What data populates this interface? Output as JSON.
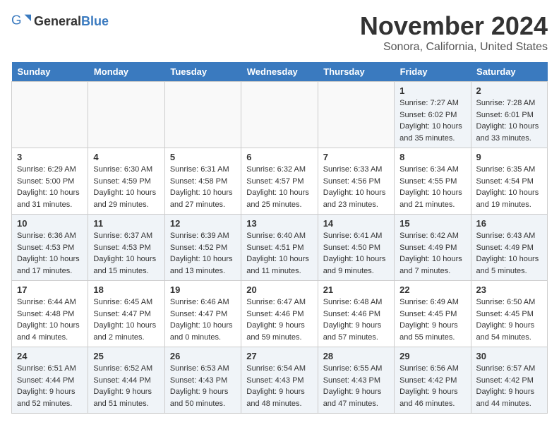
{
  "header": {
    "logo_general": "General",
    "logo_blue": "Blue",
    "month_year": "November 2024",
    "location": "Sonora, California, United States"
  },
  "weekdays": [
    "Sunday",
    "Monday",
    "Tuesday",
    "Wednesday",
    "Thursday",
    "Friday",
    "Saturday"
  ],
  "weeks": [
    [
      {
        "day": "",
        "sunrise": "",
        "sunset": "",
        "daylight": "",
        "empty": true
      },
      {
        "day": "",
        "sunrise": "",
        "sunset": "",
        "daylight": "",
        "empty": true
      },
      {
        "day": "",
        "sunrise": "",
        "sunset": "",
        "daylight": "",
        "empty": true
      },
      {
        "day": "",
        "sunrise": "",
        "sunset": "",
        "daylight": "",
        "empty": true
      },
      {
        "day": "",
        "sunrise": "",
        "sunset": "",
        "daylight": "",
        "empty": true
      },
      {
        "day": "1",
        "sunrise": "Sunrise: 7:27 AM",
        "sunset": "Sunset: 6:02 PM",
        "daylight": "Daylight: 10 hours and 35 minutes.",
        "empty": false
      },
      {
        "day": "2",
        "sunrise": "Sunrise: 7:28 AM",
        "sunset": "Sunset: 6:01 PM",
        "daylight": "Daylight: 10 hours and 33 minutes.",
        "empty": false
      }
    ],
    [
      {
        "day": "3",
        "sunrise": "Sunrise: 6:29 AM",
        "sunset": "Sunset: 5:00 PM",
        "daylight": "Daylight: 10 hours and 31 minutes.",
        "empty": false
      },
      {
        "day": "4",
        "sunrise": "Sunrise: 6:30 AM",
        "sunset": "Sunset: 4:59 PM",
        "daylight": "Daylight: 10 hours and 29 minutes.",
        "empty": false
      },
      {
        "day": "5",
        "sunrise": "Sunrise: 6:31 AM",
        "sunset": "Sunset: 4:58 PM",
        "daylight": "Daylight: 10 hours and 27 minutes.",
        "empty": false
      },
      {
        "day": "6",
        "sunrise": "Sunrise: 6:32 AM",
        "sunset": "Sunset: 4:57 PM",
        "daylight": "Daylight: 10 hours and 25 minutes.",
        "empty": false
      },
      {
        "day": "7",
        "sunrise": "Sunrise: 6:33 AM",
        "sunset": "Sunset: 4:56 PM",
        "daylight": "Daylight: 10 hours and 23 minutes.",
        "empty": false
      },
      {
        "day": "8",
        "sunrise": "Sunrise: 6:34 AM",
        "sunset": "Sunset: 4:55 PM",
        "daylight": "Daylight: 10 hours and 21 minutes.",
        "empty": false
      },
      {
        "day": "9",
        "sunrise": "Sunrise: 6:35 AM",
        "sunset": "Sunset: 4:54 PM",
        "daylight": "Daylight: 10 hours and 19 minutes.",
        "empty": false
      }
    ],
    [
      {
        "day": "10",
        "sunrise": "Sunrise: 6:36 AM",
        "sunset": "Sunset: 4:53 PM",
        "daylight": "Daylight: 10 hours and 17 minutes.",
        "empty": false
      },
      {
        "day": "11",
        "sunrise": "Sunrise: 6:37 AM",
        "sunset": "Sunset: 4:53 PM",
        "daylight": "Daylight: 10 hours and 15 minutes.",
        "empty": false
      },
      {
        "day": "12",
        "sunrise": "Sunrise: 6:39 AM",
        "sunset": "Sunset: 4:52 PM",
        "daylight": "Daylight: 10 hours and 13 minutes.",
        "empty": false
      },
      {
        "day": "13",
        "sunrise": "Sunrise: 6:40 AM",
        "sunset": "Sunset: 4:51 PM",
        "daylight": "Daylight: 10 hours and 11 minutes.",
        "empty": false
      },
      {
        "day": "14",
        "sunrise": "Sunrise: 6:41 AM",
        "sunset": "Sunset: 4:50 PM",
        "daylight": "Daylight: 10 hours and 9 minutes.",
        "empty": false
      },
      {
        "day": "15",
        "sunrise": "Sunrise: 6:42 AM",
        "sunset": "Sunset: 4:49 PM",
        "daylight": "Daylight: 10 hours and 7 minutes.",
        "empty": false
      },
      {
        "day": "16",
        "sunrise": "Sunrise: 6:43 AM",
        "sunset": "Sunset: 4:49 PM",
        "daylight": "Daylight: 10 hours and 5 minutes.",
        "empty": false
      }
    ],
    [
      {
        "day": "17",
        "sunrise": "Sunrise: 6:44 AM",
        "sunset": "Sunset: 4:48 PM",
        "daylight": "Daylight: 10 hours and 4 minutes.",
        "empty": false
      },
      {
        "day": "18",
        "sunrise": "Sunrise: 6:45 AM",
        "sunset": "Sunset: 4:47 PM",
        "daylight": "Daylight: 10 hours and 2 minutes.",
        "empty": false
      },
      {
        "day": "19",
        "sunrise": "Sunrise: 6:46 AM",
        "sunset": "Sunset: 4:47 PM",
        "daylight": "Daylight: 10 hours and 0 minutes.",
        "empty": false
      },
      {
        "day": "20",
        "sunrise": "Sunrise: 6:47 AM",
        "sunset": "Sunset: 4:46 PM",
        "daylight": "Daylight: 9 hours and 59 minutes.",
        "empty": false
      },
      {
        "day": "21",
        "sunrise": "Sunrise: 6:48 AM",
        "sunset": "Sunset: 4:46 PM",
        "daylight": "Daylight: 9 hours and 57 minutes.",
        "empty": false
      },
      {
        "day": "22",
        "sunrise": "Sunrise: 6:49 AM",
        "sunset": "Sunset: 4:45 PM",
        "daylight": "Daylight: 9 hours and 55 minutes.",
        "empty": false
      },
      {
        "day": "23",
        "sunrise": "Sunrise: 6:50 AM",
        "sunset": "Sunset: 4:45 PM",
        "daylight": "Daylight: 9 hours and 54 minutes.",
        "empty": false
      }
    ],
    [
      {
        "day": "24",
        "sunrise": "Sunrise: 6:51 AM",
        "sunset": "Sunset: 4:44 PM",
        "daylight": "Daylight: 9 hours and 52 minutes.",
        "empty": false
      },
      {
        "day": "25",
        "sunrise": "Sunrise: 6:52 AM",
        "sunset": "Sunset: 4:44 PM",
        "daylight": "Daylight: 9 hours and 51 minutes.",
        "empty": false
      },
      {
        "day": "26",
        "sunrise": "Sunrise: 6:53 AM",
        "sunset": "Sunset: 4:43 PM",
        "daylight": "Daylight: 9 hours and 50 minutes.",
        "empty": false
      },
      {
        "day": "27",
        "sunrise": "Sunrise: 6:54 AM",
        "sunset": "Sunset: 4:43 PM",
        "daylight": "Daylight: 9 hours and 48 minutes.",
        "empty": false
      },
      {
        "day": "28",
        "sunrise": "Sunrise: 6:55 AM",
        "sunset": "Sunset: 4:43 PM",
        "daylight": "Daylight: 9 hours and 47 minutes.",
        "empty": false
      },
      {
        "day": "29",
        "sunrise": "Sunrise: 6:56 AM",
        "sunset": "Sunset: 4:42 PM",
        "daylight": "Daylight: 9 hours and 46 minutes.",
        "empty": false
      },
      {
        "day": "30",
        "sunrise": "Sunrise: 6:57 AM",
        "sunset": "Sunset: 4:42 PM",
        "daylight": "Daylight: 9 hours and 44 minutes.",
        "empty": false
      }
    ]
  ]
}
